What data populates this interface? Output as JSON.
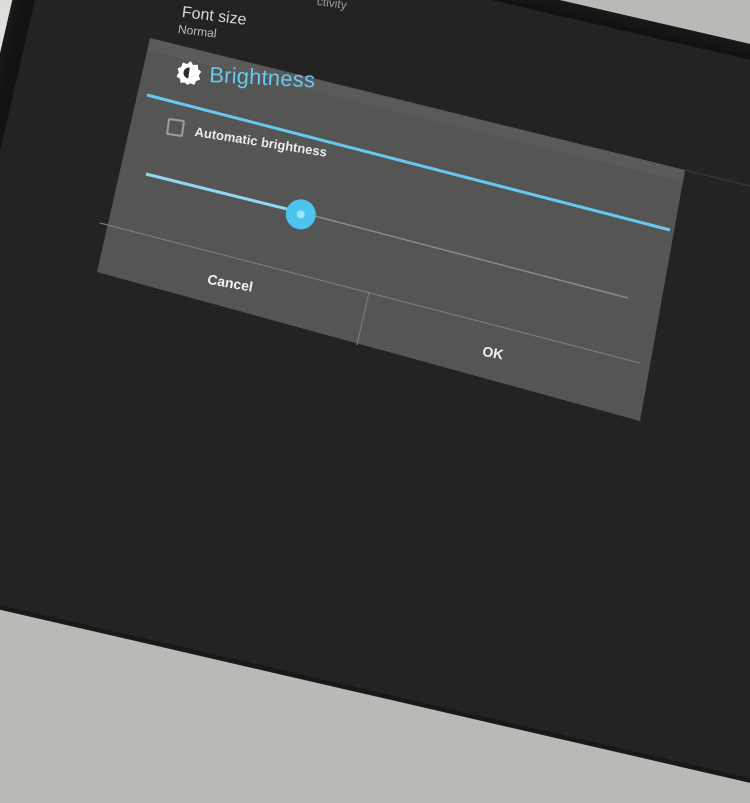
{
  "background_settings": {
    "activity_fragment": "ctivity",
    "font_size_title": "Font size",
    "font_size_value": "Normal"
  },
  "dialog": {
    "title": "Brightness",
    "title_icon": "brightness-icon",
    "auto_brightness_label": "Automatic brightness",
    "auto_brightness_checked": false,
    "slider_level": 0.3,
    "cancel_label": "Cancel",
    "ok_label": "OK"
  },
  "colors": {
    "accent": "#67c8f0",
    "dialog_bg": "#555553",
    "screen_bg": "#232323",
    "device_body": "#121212"
  }
}
